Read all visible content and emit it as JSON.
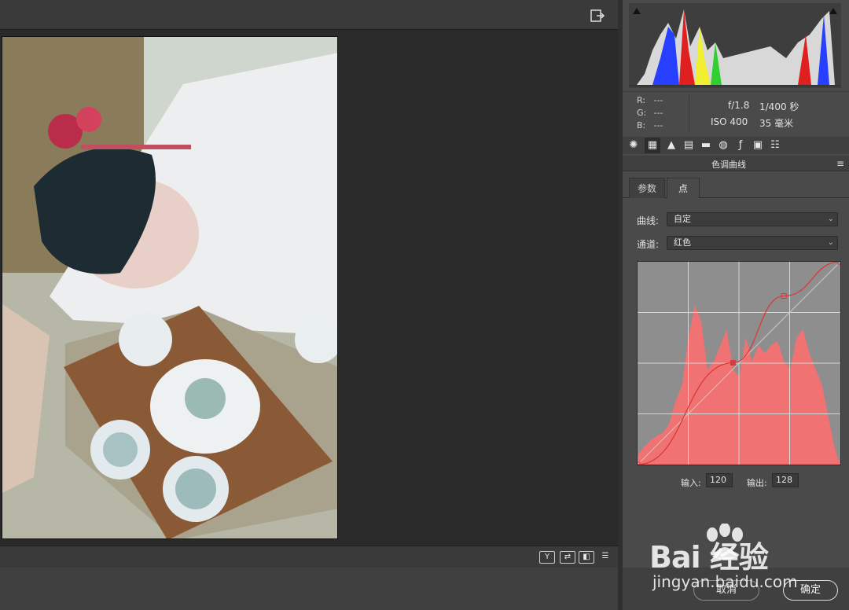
{
  "exif": {
    "aperture": "f/1.8",
    "shutter": "1/400 秒",
    "iso": "ISO 400",
    "focal": "35 毫米"
  },
  "rgb": {
    "r_label": "R:",
    "g_label": "G:",
    "b_label": "B:",
    "r": "---",
    "g": "---",
    "b": "---"
  },
  "panel": {
    "title": "色调曲线"
  },
  "tabs": [
    {
      "label": "参数"
    },
    {
      "label": "点"
    }
  ],
  "curve": {
    "label": "曲线:",
    "value": "自定"
  },
  "channel": {
    "label": "通道:",
    "value": "红色"
  },
  "io": {
    "input_label": "输入:",
    "input_value": "120",
    "output_label": "输出:",
    "output_value": "128"
  },
  "actions": {
    "cancel": "取消",
    "ok": "确定"
  },
  "bottom_tools": {
    "y_label": "Y"
  },
  "watermark": {
    "brand": "Bai  经验",
    "url": "jingyan.baidu.com"
  },
  "colors": {
    "curve_fill": "#f07272",
    "curve_line": "#d93a3a",
    "panel_bg": "#4a4a4a",
    "workspace_bg": "#2b2a2b"
  },
  "chart_data": {
    "type": "area",
    "title": "",
    "channel": "红色",
    "x": [
      0,
      8,
      16,
      24,
      32,
      40,
      48,
      56,
      64,
      72,
      80,
      88,
      96,
      104,
      112,
      120,
      128,
      136,
      144,
      152,
      160,
      168,
      176,
      184,
      192,
      200,
      208,
      216,
      224,
      232,
      240,
      248,
      255
    ],
    "values": [
      12,
      22,
      30,
      36,
      40,
      52,
      80,
      100,
      160,
      200,
      180,
      120,
      130,
      150,
      170,
      120,
      110,
      160,
      130,
      150,
      140,
      150,
      155,
      130,
      120,
      160,
      170,
      140,
      120,
      100,
      60,
      20,
      0
    ],
    "curve_points": [
      {
        "x": 0,
        "y": 0
      },
      {
        "x": 120,
        "y": 128
      },
      {
        "x": 184,
        "y": 212
      },
      {
        "x": 255,
        "y": 255
      }
    ],
    "xlim": [
      0,
      255
    ],
    "ylim": [
      0,
      255
    ],
    "grid": true
  }
}
